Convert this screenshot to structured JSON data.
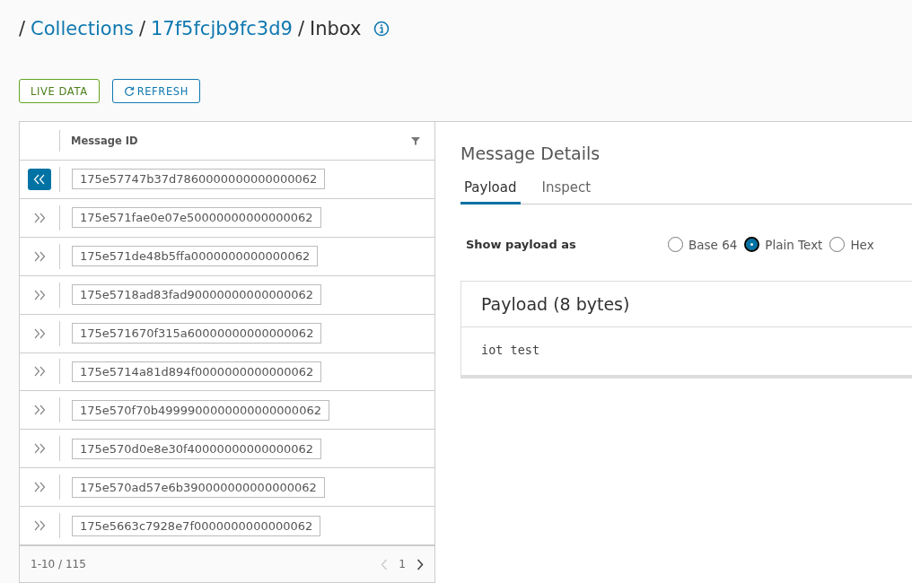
{
  "breadcrumb": [
    {
      "separator": "/",
      "label": "Collections",
      "link": true
    },
    {
      "separator": "/",
      "label": "17f5fcjb9fc3d9",
      "link": true
    },
    {
      "separator": "/",
      "label": "Inbox",
      "link": false
    }
  ],
  "actions": [
    {
      "label": "LIVE DATA",
      "kind": "live"
    },
    {
      "label": "REFRESH",
      "kind": "refresh"
    }
  ],
  "table": {
    "columns": [
      "Message ID"
    ],
    "rows": [
      {
        "id": "175e57747b37d7860000000000000062",
        "expanded": true
      },
      {
        "id": "175e571fae0e07e50000000000000062",
        "expanded": false
      },
      {
        "id": "175e571de48b5ffa0000000000000062",
        "expanded": false
      },
      {
        "id": "175e5718ad83fad90000000000000062",
        "expanded": false
      },
      {
        "id": "175e571670f315a60000000000000062",
        "expanded": false
      },
      {
        "id": "175e5714a81d894f0000000000000062",
        "expanded": false
      },
      {
        "id": "175e570f70b4999900000000000000062",
        "expanded": false
      },
      {
        "id": "175e570d0e8e30f40000000000000062",
        "expanded": false
      },
      {
        "id": "175e570ad57e6b390000000000000062",
        "expanded": false
      },
      {
        "id": "175e5663c7928e7f0000000000000062",
        "expanded": false
      }
    ],
    "footer": {
      "range": "1-10 / 115",
      "page": "1"
    }
  },
  "details": {
    "title": "Message Details",
    "tabs": [
      {
        "label": "Payload",
        "selected": true
      },
      {
        "label": "Inspect",
        "selected": false
      }
    ],
    "show_as": {
      "label": "Show payload as",
      "options": [
        {
          "label": "Base 64",
          "selected": false
        },
        {
          "label": "Plain Text",
          "selected": true
        },
        {
          "label": "Hex",
          "selected": false
        }
      ]
    },
    "payload": {
      "title": "Payload (8 bytes)",
      "content": "iot test"
    }
  }
}
